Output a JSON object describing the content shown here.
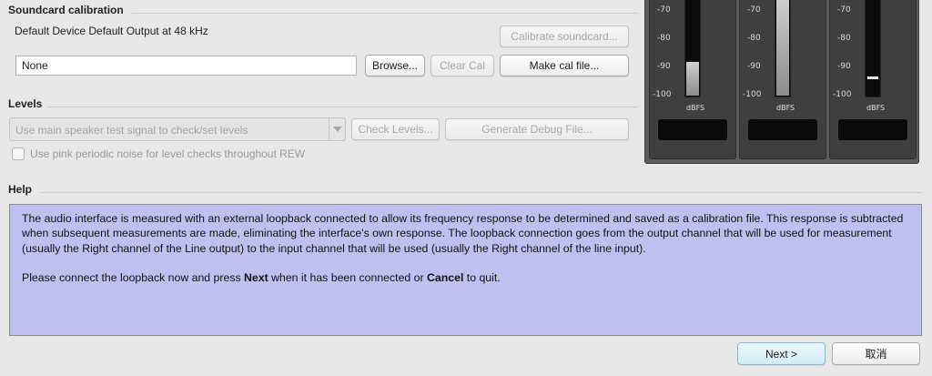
{
  "soundcard": {
    "title": "Soundcard calibration",
    "device_text": "Default Device Default Output at 48 kHz",
    "calibrate_label": "Calibrate soundcard...",
    "file_value": "None",
    "browse_label": "Browse...",
    "clear_label": "Clear Cal",
    "make_label": "Make cal file..."
  },
  "levels": {
    "title": "Levels",
    "combo_value": "Use main speaker test signal to check/set levels",
    "check_label": "Check Levels...",
    "debug_label": "Generate Debug File...",
    "pink_label": "Use pink periodic noise for level checks throughout REW"
  },
  "help": {
    "title": "Help",
    "para1": "The audio interface is measured with an external loopback connected to allow its frequency response to be determined and saved as a calibration file. This response is subtracted when subsequent measurements are made, eliminating the interface's own response. The loopback connection goes from the output channel that will be used for measurement (usually the Right channel of the Line output) to the input channel that will be used (usually the Right channel of the line input).",
    "para2_a": "Please connect the loopback now and press ",
    "para2_b": "Next",
    "para2_c": " when it has been connected or ",
    "para2_d": "Cancel",
    "para2_e": " to quit."
  },
  "meters": {
    "ticks": [
      "-70",
      "-80",
      "-90",
      "-100"
    ],
    "unit": "dBFS",
    "channels": [
      {
        "level_db": -88,
        "peak_db": null
      },
      {
        "level_db": -65,
        "peak_db": null
      },
      {
        "level_db": null,
        "peak_db": -94
      }
    ]
  },
  "footer": {
    "next_label": "Next >",
    "cancel_label": "取消"
  }
}
